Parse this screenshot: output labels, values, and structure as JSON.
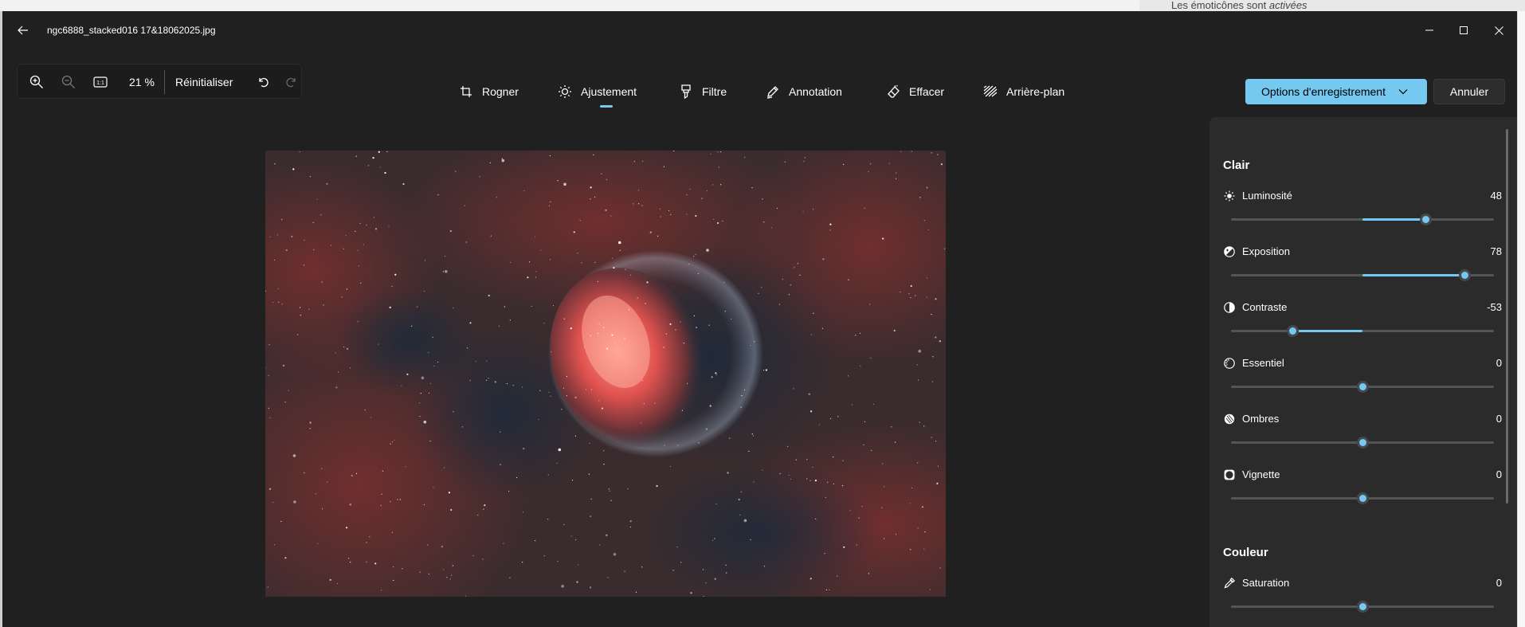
{
  "background": {
    "notification_text": "Les émoticônes sont ",
    "notification_emph": "activées"
  },
  "titlebar": {
    "file_name": "ngc6888_stacked016 17&18062025.jpg"
  },
  "toolbar": {
    "zoom_level": "21 %",
    "reset_label": "Réinitialiser"
  },
  "tabs": [
    {
      "label": "Rogner",
      "icon": "crop-icon"
    },
    {
      "label": "Ajustement",
      "icon": "brightness-icon",
      "active": true
    },
    {
      "label": "Filtre",
      "icon": "filter-icon"
    },
    {
      "label": "Annotation",
      "icon": "pen-icon"
    },
    {
      "label": "Effacer",
      "icon": "eraser-icon"
    },
    {
      "label": "Arrière-plan",
      "icon": "background-icon"
    }
  ],
  "actions": {
    "save_options_label": "Options d'enregistrement",
    "cancel_label": "Annuler"
  },
  "panel": {
    "light_section": "Clair",
    "color_section": "Couleur",
    "adjustments": [
      {
        "key": "luminosite",
        "label": "Luminosité",
        "value": "48",
        "level": 48
      },
      {
        "key": "exposition",
        "label": "Exposition",
        "value": "78",
        "level": 78
      },
      {
        "key": "contraste",
        "label": "Contraste",
        "value": "-53",
        "level": -53
      },
      {
        "key": "essentiel",
        "label": "Essentiel",
        "value": "0",
        "level": 0
      },
      {
        "key": "ombres",
        "label": "Ombres",
        "value": "0",
        "level": 0
      },
      {
        "key": "vignette",
        "label": "Vignette",
        "value": "0",
        "level": 0
      },
      {
        "key": "saturation",
        "label": "Saturation",
        "value": "0",
        "level": 0
      }
    ]
  },
  "colors": {
    "accent": "#75c8f0",
    "window_bg": "#202020",
    "panel_bg": "#2b2b2b"
  }
}
